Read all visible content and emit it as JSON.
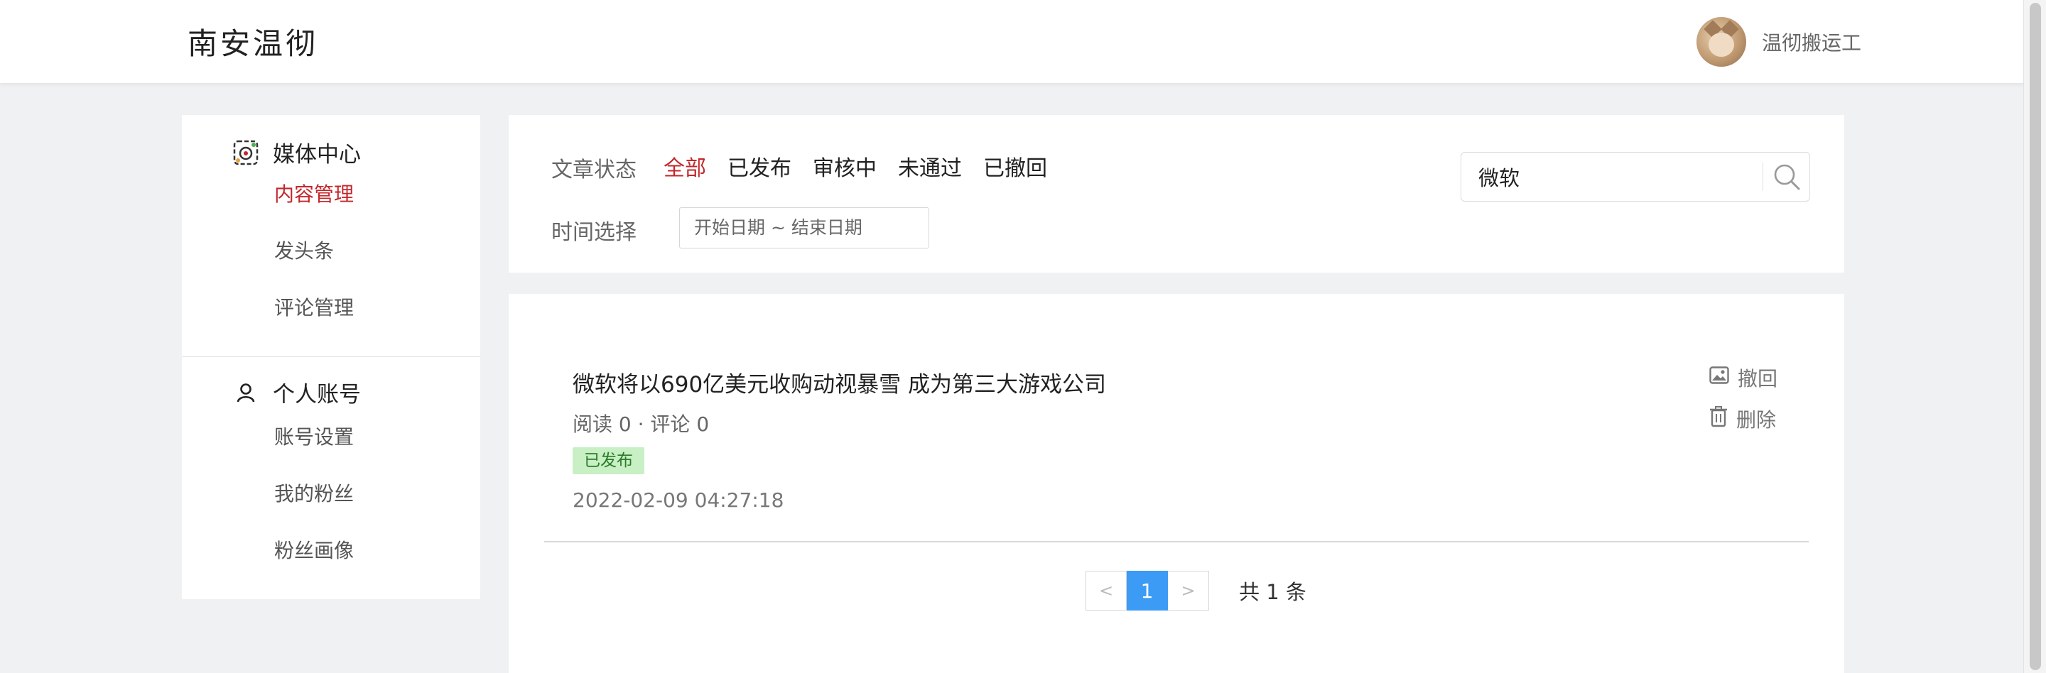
{
  "header": {
    "logo": "南安温彻",
    "user_name": "温彻搬运工"
  },
  "sidebar": {
    "media_center": {
      "title": "媒体中心",
      "icon": "media-center-icon",
      "items": [
        {
          "label": "内容管理",
          "active": true
        },
        {
          "label": "发头条",
          "active": false
        },
        {
          "label": "评论管理",
          "active": false
        }
      ]
    },
    "account": {
      "title": "个人账号",
      "icon": "user-icon",
      "items": [
        {
          "label": "账号设置"
        },
        {
          "label": "我的粉丝"
        },
        {
          "label": "粉丝画像"
        }
      ]
    }
  },
  "filter": {
    "status_label": "文章状态",
    "status_tabs": [
      "全部",
      "已发布",
      "审核中",
      "未通过",
      "已撤回"
    ],
    "active_status": "全部",
    "date_label": "时间选择",
    "date_placeholder": "开始日期 ~ 结束日期",
    "search_value": "微软"
  },
  "articles": [
    {
      "title": "微软将以690亿美元收购动视暴雪 成为第三大游戏公司",
      "meta": "阅读 0 · 评论 0",
      "status": "已发布",
      "time": "2022-02-09 04:27:18",
      "actions": {
        "revoke": "撤回",
        "delete": "删除"
      }
    }
  ],
  "pagination": {
    "prev": "<",
    "current": "1",
    "next": ">",
    "total": "共 1 条"
  },
  "colors": {
    "accent_red": "#c3272b",
    "page_blue": "#3b9bf5",
    "badge_green_bg": "#c8f0c4",
    "badge_green_text": "#2a7a2a"
  }
}
